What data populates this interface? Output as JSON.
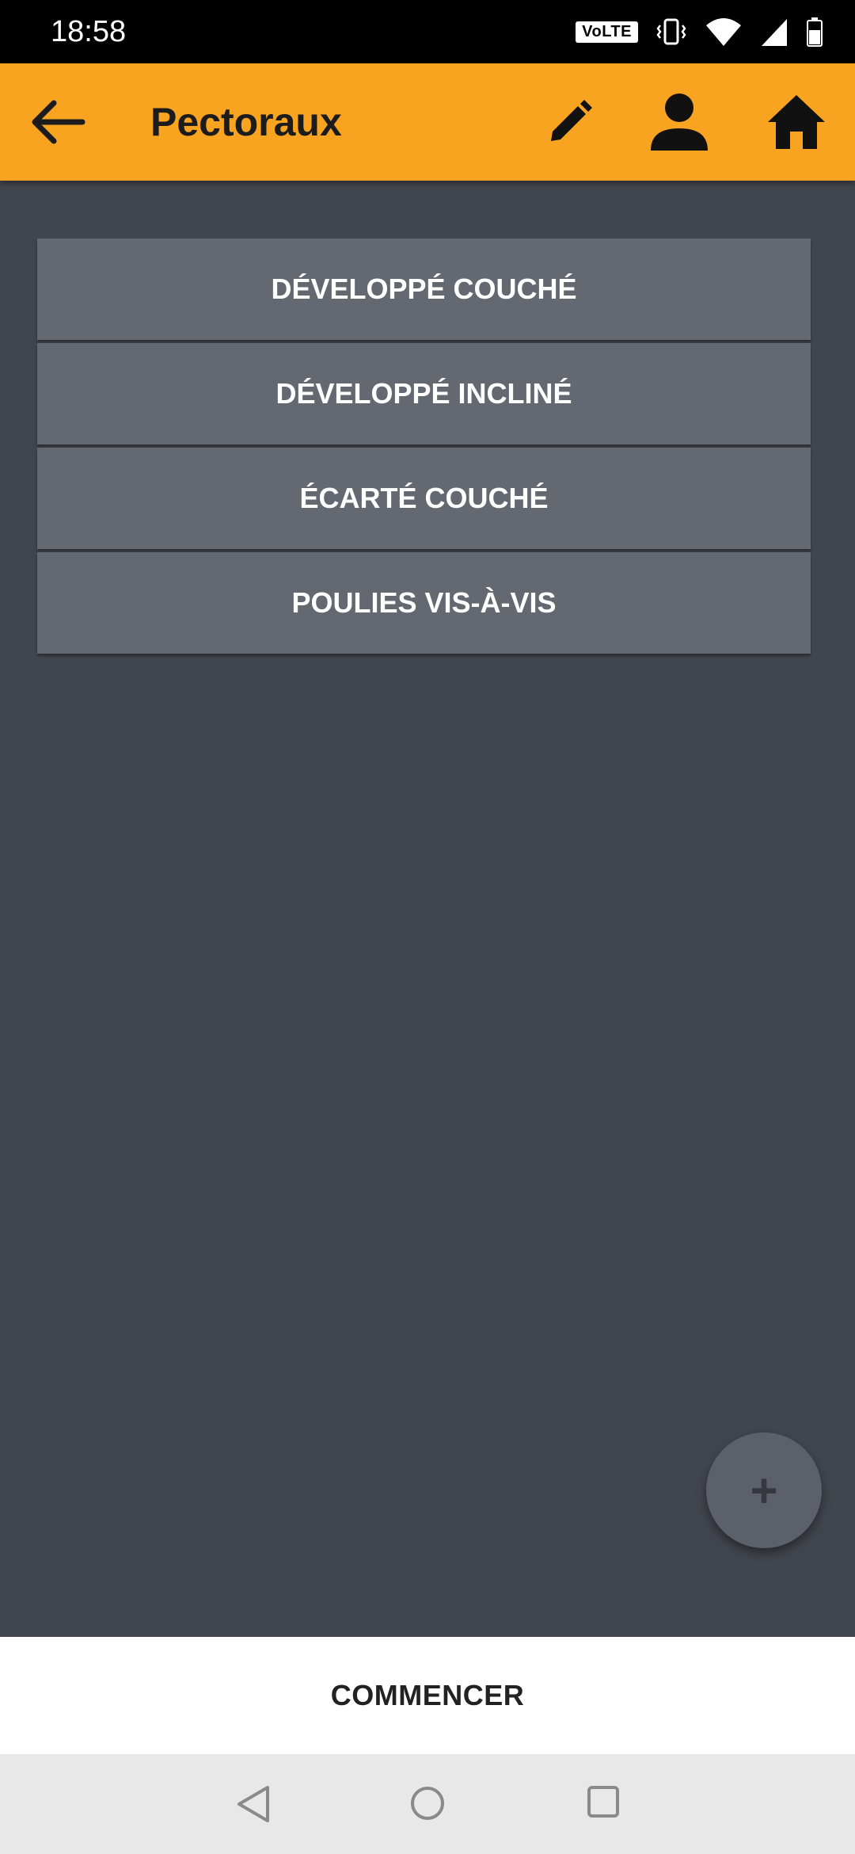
{
  "status_bar": {
    "time": "18:58",
    "volte": "VoLTE",
    "icons": [
      "vibrate-icon",
      "wifi-icon",
      "signal-icon",
      "battery-icon"
    ]
  },
  "app_bar": {
    "title": "Pectoraux",
    "background": "#f9a420",
    "icons": [
      "back-arrow-icon",
      "edit-pencil-icon",
      "person-icon",
      "home-icon"
    ]
  },
  "exercises": [
    {
      "label": "DÉVELOPPÉ COUCHÉ"
    },
    {
      "label": "DÉVELOPPÉ INCLINÉ"
    },
    {
      "label": "ÉCARTÉ COUCHÉ"
    },
    {
      "label": "POULIES VIS-À-VIS"
    }
  ],
  "fab": {
    "label": "+"
  },
  "start_button": {
    "label": "COMMENCER"
  },
  "nav_bar": {
    "icons": [
      "nav-back-icon",
      "nav-home-icon",
      "nav-recent-icon"
    ]
  },
  "colors": {
    "background": "#41454d",
    "list_item": "#646870",
    "accent": "#f9a420"
  }
}
